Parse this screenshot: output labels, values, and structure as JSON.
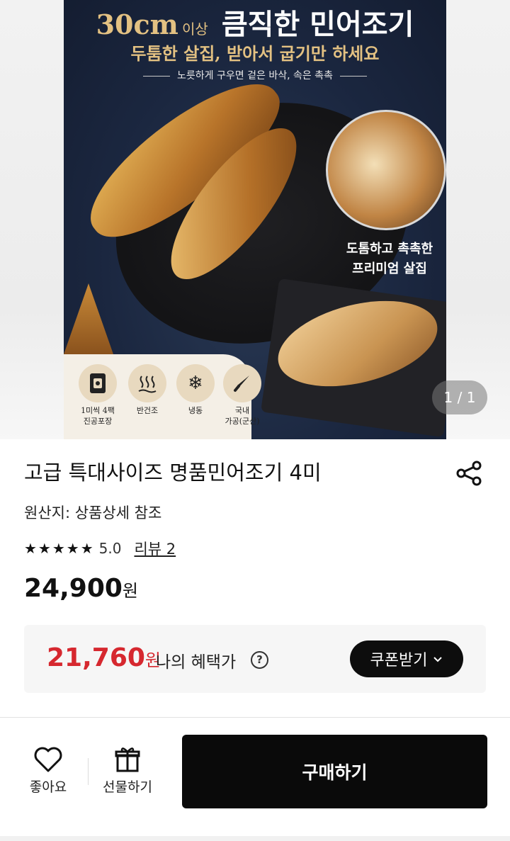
{
  "hero": {
    "headline_size": "30cm",
    "headline_unit": "이상",
    "headline_main": "큼직한 민어조기",
    "subheadline": "두툼한 살집, 받아서 굽기만 하세요",
    "tagline": "노릇하게 구우면 겉은 바삭, 속은 촉촉",
    "detail_caption_line1": "도톰하고 촉촉한",
    "detail_caption_line2": "프리미엄 살집",
    "badges": [
      {
        "icon": "vacuum-pack-icon",
        "label_line1": "1미씩 4팩",
        "label_line2": "진공포장"
      },
      {
        "icon": "half-dried-icon",
        "label_line1": "반건조",
        "label_line2": ""
      },
      {
        "icon": "snowflake-icon",
        "label_line1": "냉동",
        "label_line2": ""
      },
      {
        "icon": "knife-icon",
        "label_line1": "국내",
        "label_line2": "가공(군산)"
      }
    ],
    "page_counter": "1 / 1"
  },
  "product": {
    "title": "고급 특대사이즈 명품민어조기 4미",
    "origin": "원산지: 상품상세 참조",
    "stars": "★★★★★",
    "rating": "5.0",
    "review_link": "리뷰 2",
    "price": "24,900",
    "price_unit": "원"
  },
  "benefit": {
    "price": "21,760",
    "price_unit": "원",
    "label": "나의 혜택가",
    "help": "?",
    "coupon_button": "쿠폰받기",
    "coupon_chevron": "⌄"
  },
  "bottom_bar": {
    "like_label": "좋아요",
    "gift_label": "선물하기",
    "buy_button": "구매하기"
  },
  "colors": {
    "accent_red": "#d6282f",
    "button_black": "#0a0a0a",
    "poster_navy": "#1b2740",
    "poster_gold": "#e3c182"
  }
}
